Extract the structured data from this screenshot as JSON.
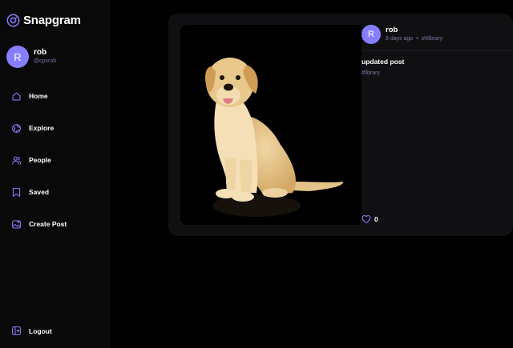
{
  "app": {
    "name": "Snapgram",
    "accent": "#877eff"
  },
  "user": {
    "initial": "R",
    "name": "rob",
    "handle": "@cpxrob"
  },
  "nav": [
    {
      "label": "Home",
      "icon": "home-icon"
    },
    {
      "label": "Explore",
      "icon": "explore-icon"
    },
    {
      "label": "People",
      "icon": "people-icon"
    },
    {
      "label": "Saved",
      "icon": "saved-icon"
    },
    {
      "label": "Create Post",
      "icon": "create-post-icon"
    }
  ],
  "logout": {
    "label": "Logout",
    "icon": "logout-icon"
  },
  "post": {
    "author_initial": "R",
    "author": "rob",
    "time": "8 days ago",
    "dot": "•",
    "location": "shlibrary",
    "caption": "updated post",
    "tag": "#library",
    "likes": "0",
    "image": "golden-retriever-puppy-photo"
  }
}
